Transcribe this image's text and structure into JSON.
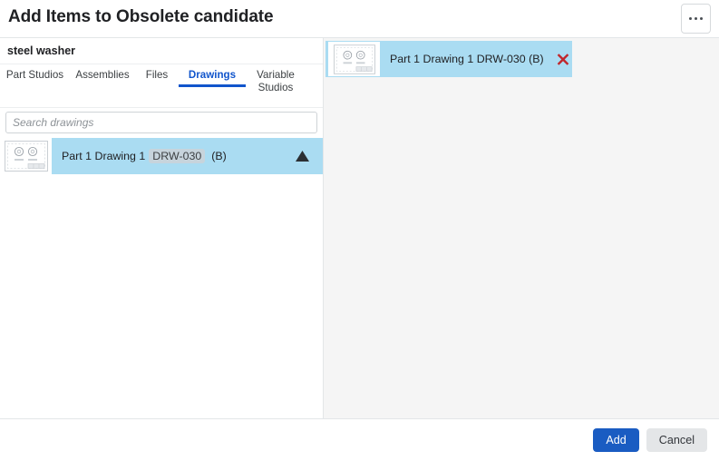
{
  "header": {
    "title": "Add Items to Obsolete candidate",
    "more_options_icon": "ellipsis-horizontal-icon"
  },
  "left_panel": {
    "context_label": "steel washer",
    "tabs": [
      {
        "label": "Part Studios",
        "active": false
      },
      {
        "label": "Assemblies",
        "active": false
      },
      {
        "label": "Files",
        "active": false
      },
      {
        "label": "Drawings",
        "active": true
      },
      {
        "label": "Variable Studios",
        "active": false
      }
    ],
    "search": {
      "placeholder": "Search drawings",
      "value": ""
    },
    "results": [
      {
        "thumbnail_icon": "drawing-sheet-thumbnail",
        "title": "Part 1 Drawing 1",
        "badge": "DRW-030",
        "revision": "(B)",
        "expander_icon": "triangle-up-icon",
        "selected": true
      }
    ]
  },
  "right_panel": {
    "selected_items": [
      {
        "thumbnail_icon": "drawing-sheet-thumbnail",
        "label": "Part 1 Drawing 1 DRW-030 (B)",
        "remove_icon": "close-x-icon"
      }
    ]
  },
  "footer": {
    "add_label": "Add",
    "cancel_label": "Cancel"
  },
  "colors": {
    "accent_blue": "#1155cc",
    "primary_button": "#1a5cc2",
    "selection_highlight": "#aadcf2",
    "badge_background": "#c7d4dc",
    "remove_red": "#c0262b",
    "right_panel_background": "#f5f5f5"
  }
}
